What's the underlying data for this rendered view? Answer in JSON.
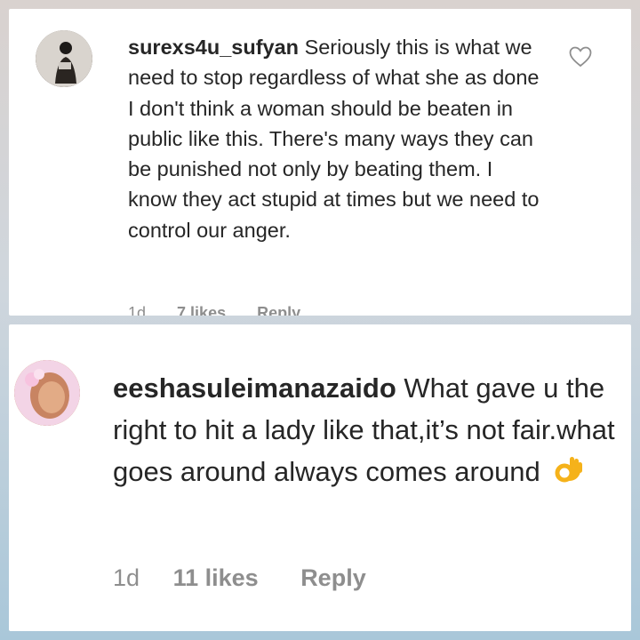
{
  "comments": [
    {
      "username": "surexs4u_sufyan",
      "text": "Seriously this is what we need to stop regardless of what she as done I don't think a woman should be beaten in public like this. There's many ways they can be punished not only by beating them. I know they act stupid at times but we need to control our anger.",
      "age": "1d",
      "likes": "7 likes",
      "reply": "Reply",
      "avatar_icon": "user-avatar",
      "like_icon": "heart-outline-icon"
    },
    {
      "username": "eeshasuleimanazaido",
      "text": "What gave u the right to hit a lady like that,it’s not fair.what goes around always comes around",
      "emoji": "ok-hand-emoji",
      "age": "1d",
      "likes": "11 likes",
      "reply": "Reply",
      "avatar_icon": "user-avatar"
    }
  ],
  "colors": {
    "text": "#262626",
    "meta": "#8e8e8e",
    "card": "#ffffff"
  }
}
